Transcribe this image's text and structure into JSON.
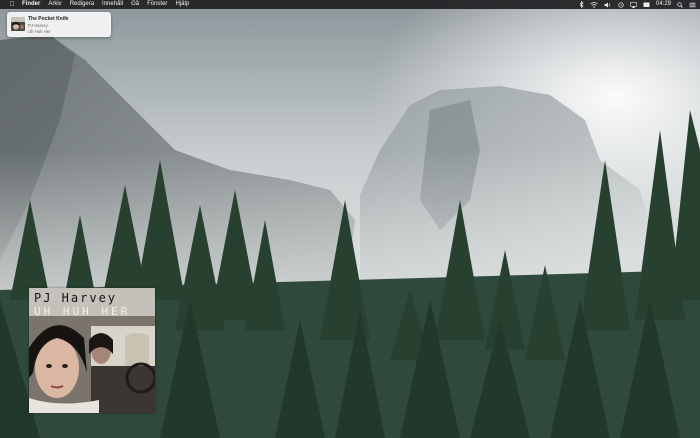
{
  "menubar": {
    "app_name": "Finder",
    "items": [
      "Arkiv",
      "Redigera",
      "Innehåll",
      "Gå",
      "Fönster",
      "Hjälp"
    ],
    "clock": "04:29",
    "status_icons": [
      "bluetooth-icon",
      "wifi-icon",
      "volume-icon",
      "sync-icon",
      "airplay-icon",
      "screen-icon",
      "search-icon",
      "notification-center-icon"
    ]
  },
  "notification": {
    "title": "The Pocket Knife",
    "artist": "PJ Harvey",
    "album": "Uh Huh Her"
  },
  "album_art": {
    "artist_text": "PJ Harvey",
    "title_text": "UH HUH HER"
  },
  "colors": {
    "menubar_bg": "#1e2022",
    "notification_bg": "#f6f6f6"
  }
}
